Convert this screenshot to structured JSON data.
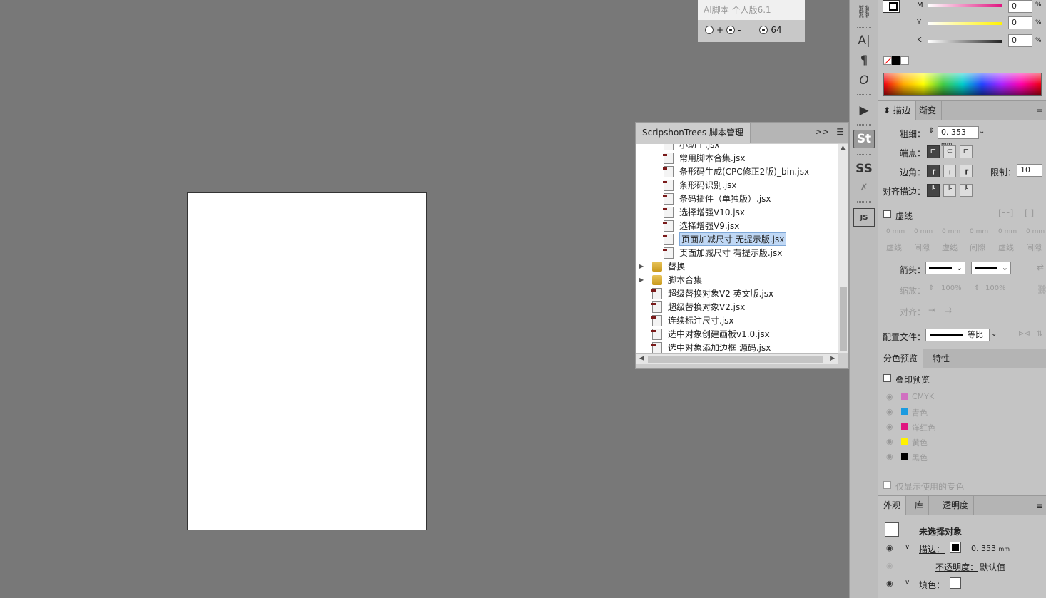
{
  "ai_panel": {
    "title": "AI脚本 个人版6.1",
    "plus": "+",
    "minus": "-",
    "count": "64"
  },
  "tree_panel": {
    "tab": "ScripshonTrees 脚本管理",
    "expand_icon": ">>",
    "menu_icon": "menu-icon",
    "items": [
      {
        "label": "小助手.jsx",
        "type": "file",
        "level": 2
      },
      {
        "label": "常用脚本合集.jsx",
        "type": "file",
        "level": 2
      },
      {
        "label": "条形码生成(CPC修正2版)_bin.jsx",
        "type": "file",
        "level": 2
      },
      {
        "label": "条形码识别.jsx",
        "type": "file",
        "level": 2
      },
      {
        "label": "条码插件（单独版）.jsx",
        "type": "file",
        "level": 2
      },
      {
        "label": "选择增强V10.jsx",
        "type": "file",
        "level": 2
      },
      {
        "label": "选择增强V9.jsx",
        "type": "file",
        "level": 2
      },
      {
        "label": "页面加减尺寸 无提示版.jsx",
        "type": "file",
        "level": 2,
        "selected": true
      },
      {
        "label": "页面加减尺寸 有提示版.jsx",
        "type": "file",
        "level": 2
      },
      {
        "label": "替换",
        "type": "folder",
        "level": 1
      },
      {
        "label": "脚本合集",
        "type": "folder",
        "level": 1
      },
      {
        "label": "超级替换对象V2 英文版.jsx",
        "type": "file",
        "level": 1
      },
      {
        "label": "超级替换对象V2.jsx",
        "type": "file",
        "level": 1
      },
      {
        "label": "连续标注尺寸.jsx",
        "type": "file",
        "level": 1
      },
      {
        "label": "选中对象创建画板v1.0.jsx",
        "type": "file",
        "level": 1
      },
      {
        "label": "选中对象添加边框 源码.jsx",
        "type": "file",
        "level": 1
      }
    ]
  },
  "color": {
    "m_label": "M",
    "m_value": "0",
    "y_label": "Y",
    "y_value": "0",
    "k_label": "K",
    "k_value": "0",
    "percent": "%"
  },
  "stroke": {
    "tab_stroke": "描边",
    "tab_gradient": "渐变",
    "weight_label": "粗细：",
    "weight_value": "0. 353",
    "weight_unit": "mm",
    "cap_label": "端点：",
    "corner_label": "边角：",
    "limit_label": "限制：",
    "limit_value": "10",
    "align_label": "对齐描边：",
    "dashed_label": "虚线",
    "dash_mm": "0 mm",
    "dash": "虚线",
    "gap": "间隙",
    "arrow_label": "箭头：",
    "scale_label": "缩放：",
    "scale_value": "100%",
    "align2_label": "对齐：",
    "profile_label": "配置文件：",
    "profile_value": "等比"
  },
  "separations": {
    "tab_preview": "分色预览",
    "tab_attr": "特性",
    "overprint_label": "叠印预览",
    "inks": [
      {
        "name": "CMYK",
        "color": "#d070c0"
      },
      {
        "name": "青色",
        "color": "#1b9be0"
      },
      {
        "name": "洋红色",
        "color": "#e0157f"
      },
      {
        "name": "黄色",
        "color": "#fff200"
      },
      {
        "name": "黑色",
        "color": "#000000"
      }
    ],
    "spot_only": "仅显示使用的专色"
  },
  "appearance": {
    "tab_appearance": "外观",
    "tab_library": "库",
    "tab_transparency": "透明度",
    "no_selection": "未选择对象",
    "stroke_label": "描边：",
    "stroke_value": "0. 353",
    "stroke_unit": "mm",
    "opacity_label": "不透明度：",
    "opacity_value": "默认值",
    "fill_label": "填色："
  }
}
